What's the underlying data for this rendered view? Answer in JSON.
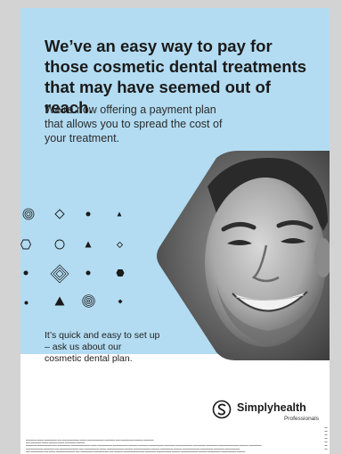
{
  "poster": {
    "headline": "We’ve an easy way to pay for those cosmetic dental treatments that may have seemed out of reach.",
    "subheading": "We’re now offering a payment plan that allows you to spread the cost of your treatment.",
    "caption": "It’s quick and easy to set up – ask us about our cosmetic dental plan."
  },
  "brand": {
    "name": "Simplyhealth",
    "tagline": "Professionals",
    "color": "#1a1a1a"
  },
  "colors": {
    "panel_background": "#b3dcf2",
    "page_background": "#d3d3d3"
  },
  "decorative_shapes": [
    "concentric-circle",
    "outline-diamond",
    "dot",
    "small-triangle",
    "outline-hexagon",
    "outline-circle",
    "triangle",
    "small-diamond",
    "dot",
    "concentric-diamond",
    "dot",
    "hexagon",
    "dot",
    "triangle",
    "concentric-circle",
    "small-diamond"
  ]
}
